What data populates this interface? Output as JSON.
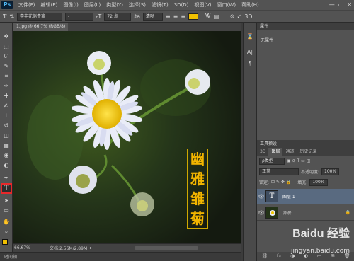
{
  "app": {
    "logo": "Ps"
  },
  "menubar": {
    "items": [
      "文件(F)",
      "编辑(E)",
      "图像(I)",
      "图层(L)",
      "类型(Y)",
      "选择(S)",
      "滤镜(T)",
      "3D(D)",
      "视图(V)",
      "窗口(W)",
      "帮助(H)"
    ],
    "window_buttons": [
      "—",
      "▭",
      "✕"
    ]
  },
  "options_bar": {
    "tool_icon": "T",
    "font_family": "李丰花俏青篆",
    "font_style": "-",
    "font_size": "72 点",
    "antialias": "清晰",
    "text_color": "#f0c000",
    "icons": [
      "orientation-icon",
      "size-icon",
      "aa-icon",
      "align-left-icon",
      "align-center-icon",
      "align-right-icon",
      "warp-icon",
      "panel-icon",
      "cancel-icon",
      "commit-icon",
      "3d-icon"
    ]
  },
  "document": {
    "tab_label": "1.jpg @ 66.7% (RGB/8)"
  },
  "canvas": {
    "text_chars": [
      "幽",
      "雅",
      "雏",
      "菊"
    ]
  },
  "tools": [
    {
      "name": "move-tool",
      "glyph": "✥"
    },
    {
      "name": "marquee-tool",
      "glyph": "⬚"
    },
    {
      "name": "lasso-tool",
      "glyph": "ᘏ"
    },
    {
      "name": "quick-select-tool",
      "glyph": "✎"
    },
    {
      "name": "crop-tool",
      "glyph": "⌗"
    },
    {
      "name": "eyedropper-tool",
      "glyph": "✑"
    },
    {
      "name": "healing-tool",
      "glyph": "✚"
    },
    {
      "name": "brush-tool",
      "glyph": "✍"
    },
    {
      "name": "stamp-tool",
      "glyph": "⊥"
    },
    {
      "name": "history-brush-tool",
      "glyph": "↺"
    },
    {
      "name": "eraser-tool",
      "glyph": "◫"
    },
    {
      "name": "gradient-tool",
      "glyph": "▦"
    },
    {
      "name": "blur-tool",
      "glyph": "◉"
    },
    {
      "name": "dodge-tool",
      "glyph": "◐"
    },
    {
      "name": "pen-tool",
      "glyph": "✒"
    },
    {
      "name": "type-tool",
      "glyph": "T"
    },
    {
      "name": "path-select-tool",
      "glyph": "➤"
    },
    {
      "name": "shape-tool",
      "glyph": "▭"
    },
    {
      "name": "hand-tool",
      "glyph": "✋"
    },
    {
      "name": "zoom-tool",
      "glyph": "⌕"
    }
  ],
  "status": {
    "zoom": "66.67%",
    "doc_size": "文档:2.56M/2.89M",
    "timeline": "时间轴"
  },
  "properties_panel": {
    "title": "属性",
    "empty_text": "无属性"
  },
  "tool_presets_panel": {
    "title": "工具预设"
  },
  "layers_panel": {
    "tabs": [
      "3D",
      "图层",
      "通道",
      "历史记录"
    ],
    "active_tab": "图层",
    "filter_label": "ρ类型",
    "blend_mode": "正常",
    "opacity_label": "不透明度:",
    "opacity_value": "100%",
    "lock_label": "锁定:",
    "fill_label": "填充:",
    "fill_value": "100%",
    "layers": [
      {
        "name": "图层 1",
        "selected": true,
        "thumb": "T"
      },
      {
        "name": "背景",
        "selected": false,
        "thumb": ""
      }
    ],
    "bottom_icons": [
      "⛓",
      "fx",
      "◑",
      "◐",
      "▭",
      "⊞",
      "🗑"
    ]
  },
  "watermark": {
    "text": "Baidu 经验",
    "url": "jingyan.baidu.com"
  },
  "colors": {
    "accent_red": "#e8282a",
    "text_yellow": "#f3b600",
    "selected_layer": "#596a80"
  }
}
